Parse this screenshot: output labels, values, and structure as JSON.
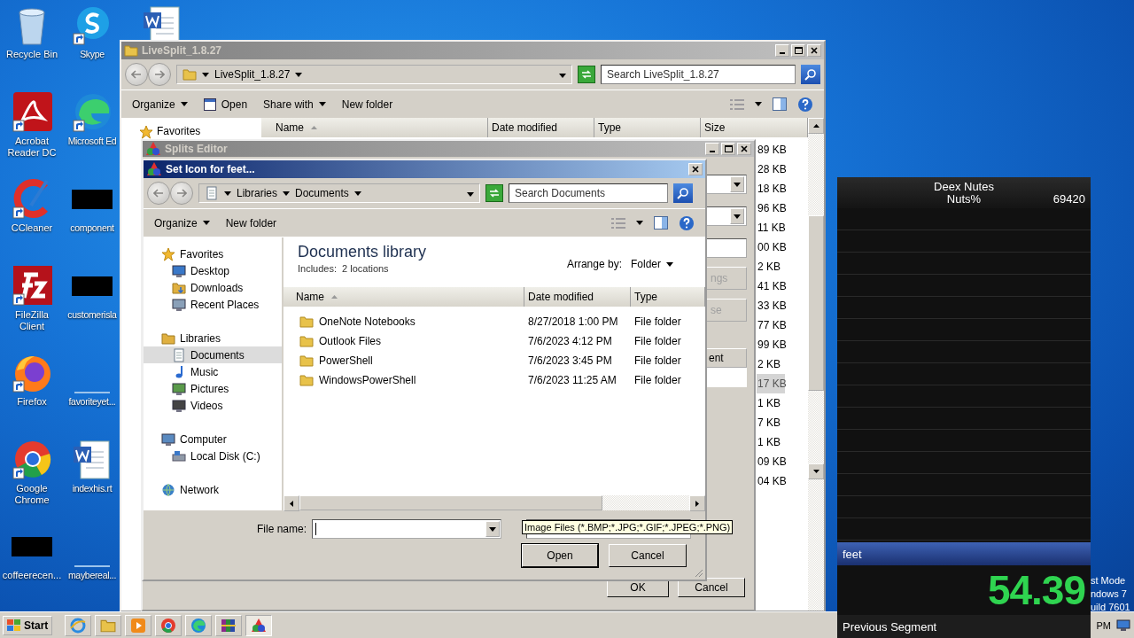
{
  "desktop_icons": [
    {
      "label": "Recycle Bin",
      "kind": "recycle",
      "shortcut": false
    },
    {
      "label": "Skype",
      "kind": "skype",
      "shortcut": true
    },
    {
      "label": "Acrobat Reader DC",
      "kind": "acrobat",
      "shortcut": true
    },
    {
      "label": "Microsoft Ed",
      "kind": "edge",
      "shortcut": true
    },
    {
      "label": "CCleaner",
      "kind": "ccleaner",
      "shortcut": true
    },
    {
      "label": "component",
      "kind": "redacted"
    },
    {
      "label": "FileZilla Client",
      "kind": "filezilla",
      "shortcut": true
    },
    {
      "label": "customerisla",
      "kind": "redacted"
    },
    {
      "label": "Firefox",
      "kind": "firefox",
      "shortcut": true
    },
    {
      "label": "favoriteyet...",
      "kind": "blank"
    },
    {
      "label": "Google Chrome",
      "kind": "chrome",
      "shortcut": true
    },
    {
      "label": "indexhis.rt",
      "kind": "word",
      "shortcut": false
    },
    {
      "label": "coffeerecen...",
      "kind": "redacted"
    },
    {
      "label": "maybereal...",
      "kind": "blank"
    }
  ],
  "desktop_text": [
    "st Mode",
    "ndows 7",
    "uild 7601"
  ],
  "explorer": {
    "title": "LiveSplit_1.8.27",
    "path": "LiveSplit_1.8.27",
    "search_placeholder": "Search LiveSplit_1.8.27",
    "toolbar": [
      {
        "label": "Organize",
        "kind": "menu"
      },
      {
        "label": "Open",
        "kind": "open"
      },
      {
        "label": "Share with",
        "kind": "menu"
      },
      {
        "label": "New folder",
        "kind": "plain"
      }
    ],
    "nav": [
      "Favorites"
    ],
    "columns": [
      "Name",
      "Date modified",
      "Type",
      "Size"
    ],
    "sizes": [
      {
        "text": "89 KB",
        "selected": false
      },
      {
        "text": "28 KB",
        "selected": false
      },
      {
        "text": "18 KB",
        "selected": false
      },
      {
        "text": "96 KB",
        "selected": false
      },
      {
        "text": "11 KB",
        "selected": false
      },
      {
        "text": "00 KB",
        "selected": false
      },
      {
        "text": "2 KB",
        "selected": false
      },
      {
        "text": "41 KB",
        "selected": false
      },
      {
        "text": "33 KB",
        "selected": false
      },
      {
        "text": "77 KB",
        "selected": false
      },
      {
        "text": "99 KB",
        "selected": false
      },
      {
        "text": "2 KB",
        "selected": false
      },
      {
        "text": "17 KB",
        "selected": true
      },
      {
        "text": "1 KB",
        "selected": false
      },
      {
        "text": "7 KB",
        "selected": false
      },
      {
        "text": "1 KB",
        "selected": false
      },
      {
        "text": "09 KB",
        "selected": false
      },
      {
        "text": "04 KB",
        "selected": false
      }
    ]
  },
  "splits_editor": {
    "title": "Splits Editor",
    "side_buttons": [
      "ngs",
      "se"
    ],
    "column": "ent",
    "buttons": [
      "OK",
      "Cancel"
    ]
  },
  "dialog": {
    "title": "Set Icon for feet...",
    "breadcrumb": [
      "Libraries",
      "Documents"
    ],
    "search_placeholder": "Search Documents",
    "toolbar": [
      {
        "label": "Organize",
        "kind": "menu"
      },
      {
        "label": "New folder",
        "kind": "plain"
      }
    ],
    "nav": [
      {
        "label": "Favorites",
        "kind": "star",
        "selected": false,
        "children": [
          {
            "label": "Desktop",
            "kind": "desktop",
            "selected": false
          },
          {
            "label": "Downloads",
            "kind": "download",
            "selected": false
          },
          {
            "label": "Recent Places",
            "kind": "recent",
            "selected": false
          }
        ]
      },
      {
        "label": "Libraries",
        "kind": "library",
        "selected": false,
        "children": [
          {
            "label": "Documents",
            "kind": "document",
            "selected": true
          },
          {
            "label": "Music",
            "kind": "music",
            "selected": false
          },
          {
            "label": "Pictures",
            "kind": "picture",
            "selected": false
          },
          {
            "label": "Videos",
            "kind": "video",
            "selected": false
          }
        ]
      },
      {
        "label": "Computer",
        "kind": "computer",
        "selected": false,
        "children": [
          {
            "label": "Local Disk (C:)",
            "kind": "disk",
            "selected": false
          }
        ]
      },
      {
        "label": "Network",
        "kind": "network",
        "selected": false
      }
    ],
    "library_title": "Documents library",
    "includes_label": "Includes:",
    "includes_value": "2 locations",
    "arrange_label": "Arrange by:",
    "arrange_value": "Folder",
    "columns": [
      "Name",
      "Date modified",
      "Type"
    ],
    "files": [
      {
        "name": "OneNote Notebooks",
        "date": "8/27/2018 1:00 PM",
        "type": "File folder"
      },
      {
        "name": "Outlook Files",
        "date": "7/6/2023 4:12 PM",
        "type": "File folder"
      },
      {
        "name": "PowerShell",
        "date": "7/6/2023 3:45 PM",
        "type": "File folder"
      },
      {
        "name": "WindowsPowerShell",
        "date": "7/6/2023 11:25 AM",
        "type": "File folder"
      }
    ],
    "file_name_label": "File name:",
    "file_type_tooltip": "Image Files (*.BMP;*.JPG;*.GIF;*.JPEG;*.PNG)",
    "buttons": [
      "Open",
      "Cancel"
    ]
  },
  "timer": {
    "game": "Deex Nutes",
    "category": "Nuts%",
    "attempts": "69420",
    "segments": [
      {
        "name": "feet",
        "selected": true
      }
    ],
    "time": "54.39",
    "footer": "Previous Segment"
  },
  "taskbar": {
    "start": "Start",
    "apps": [
      {
        "kind": "ie",
        "selected": false
      },
      {
        "kind": "folder",
        "selected": false
      },
      {
        "kind": "media",
        "selected": false
      },
      {
        "kind": "chrome",
        "selected": false
      },
      {
        "kind": "edge",
        "selected": false
      },
      {
        "kind": "winrar",
        "selected": false
      },
      {
        "kind": "livesplit",
        "selected": true
      }
    ],
    "clock": "PM"
  }
}
